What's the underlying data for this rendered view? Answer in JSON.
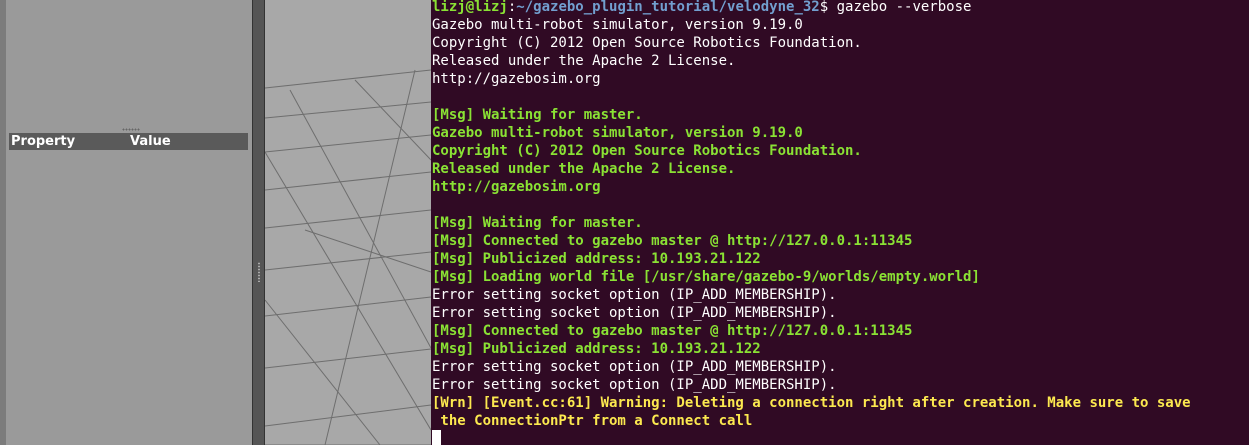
{
  "properties_panel": {
    "col_property": "Property",
    "col_value": "Value"
  },
  "terminal": {
    "prompt": {
      "user_host": "lizj@lizj",
      "separator": ":",
      "path": "~/gazebo_plugin_tutorial/velodyne_32",
      "dollar": "$ ",
      "command": "gazebo --verbose"
    },
    "lines": [
      {
        "style": "white",
        "text": "Gazebo multi-robot simulator, version 9.19.0"
      },
      {
        "style": "white",
        "text": "Copyright (C) 2012 Open Source Robotics Foundation."
      },
      {
        "style": "white",
        "text": "Released under the Apache 2 License."
      },
      {
        "style": "white",
        "text": "http://gazebosim.org"
      },
      {
        "style": "white",
        "text": ""
      },
      {
        "style": "green",
        "text": "[Msg] Waiting for master."
      },
      {
        "style": "green",
        "text": "Gazebo multi-robot simulator, version 9.19.0"
      },
      {
        "style": "green",
        "text": "Copyright (C) 2012 Open Source Robotics Foundation."
      },
      {
        "style": "green",
        "text": "Released under the Apache 2 License."
      },
      {
        "style": "green",
        "text": "http://gazebosim.org"
      },
      {
        "style": "white",
        "text": ""
      },
      {
        "style": "green",
        "text": "[Msg] Waiting for master."
      },
      {
        "style": "green",
        "text": "[Msg] Connected to gazebo master @ http://127.0.0.1:11345"
      },
      {
        "style": "green",
        "text": "[Msg] Publicized address: 10.193.21.122"
      },
      {
        "style": "green",
        "text": "[Msg] Loading world file [/usr/share/gazebo-9/worlds/empty.world]"
      },
      {
        "style": "white",
        "text": "Error setting socket option (IP_ADD_MEMBERSHIP)."
      },
      {
        "style": "white",
        "text": "Error setting socket option (IP_ADD_MEMBERSHIP)."
      },
      {
        "style": "green",
        "text": "[Msg] Connected to gazebo master @ http://127.0.0.1:11345"
      },
      {
        "style": "green",
        "text": "[Msg] Publicized address: 10.193.21.122"
      },
      {
        "style": "white",
        "text": "Error setting socket option (IP_ADD_MEMBERSHIP)."
      },
      {
        "style": "white",
        "text": "Error setting socket option (IP_ADD_MEMBERSHIP)."
      },
      {
        "style": "yellow",
        "text": "[Wrn] [Event.cc:61] Warning: Deleting a connection right after creation. Make sure to save"
      },
      {
        "style": "yellow",
        "text": " the ConnectionPtr from a Connect call"
      }
    ]
  }
}
